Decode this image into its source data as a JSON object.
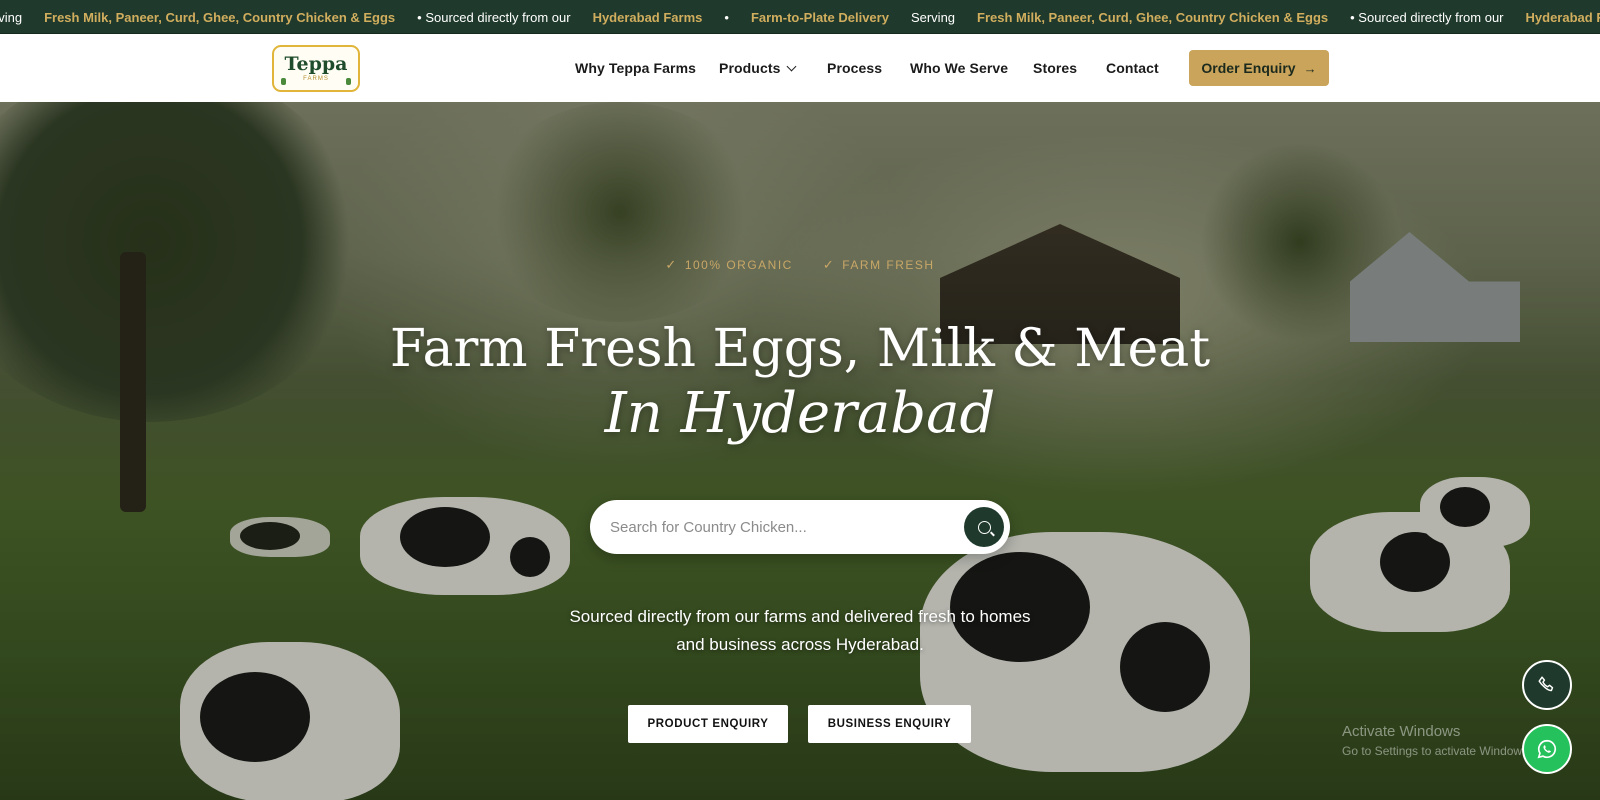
{
  "ticker": {
    "segments": [
      {
        "text": "Serving",
        "tone": "white"
      },
      {
        "text": "Fresh Milk, Paneer, Curd, Ghee, Country Chicken & Eggs",
        "tone": "gold"
      },
      {
        "text": "• Sourced directly from our",
        "tone": "white"
      },
      {
        "text": "Hyderabad Farms",
        "tone": "gold"
      },
      {
        "text": "•",
        "tone": "white"
      },
      {
        "text": "Farm-to-Plate Delivery",
        "tone": "gold"
      },
      {
        "text": "Serving",
        "tone": "white"
      },
      {
        "text": "Fresh Milk, Paneer, Curd, Ghee, Country Chicken & Eggs",
        "tone": "gold"
      },
      {
        "text": "• Sourced directly from our",
        "tone": "white"
      },
      {
        "text": "Hyderabad Farms",
        "tone": "gold"
      }
    ]
  },
  "header": {
    "logo": {
      "name": "Teppa",
      "sub": "FARMS"
    },
    "nav": [
      {
        "label": "Why Teppa Farms"
      },
      {
        "label": "Products",
        "dropdown": true
      },
      {
        "label": "Process"
      },
      {
        "label": "Who We Serve"
      },
      {
        "label": "Stores"
      },
      {
        "label": "Contact"
      }
    ],
    "order_button": "Order Enquiry"
  },
  "hero": {
    "badges": [
      "100% ORGANIC",
      "FARM FRESH"
    ],
    "title_line1": "Farm Fresh Eggs, Milk & Meat",
    "title_line2": "In Hyderabad",
    "search": {
      "placeholder": "Search for Country Chicken..."
    },
    "subtitle_line1": "Sourced directly from our farms and delivered fresh to homes",
    "subtitle_line2": "and business across Hyderabad.",
    "cta_product": "PRODUCT ENQUIRY",
    "cta_business": "BUSINESS ENQUIRY"
  },
  "watermark": {
    "title": "Activate Windows",
    "subtitle": "Go to Settings to activate Windows."
  },
  "colors": {
    "brand_green": "#1f3a2c",
    "gold": "#c9a45a",
    "whatsapp": "#25c15c"
  }
}
